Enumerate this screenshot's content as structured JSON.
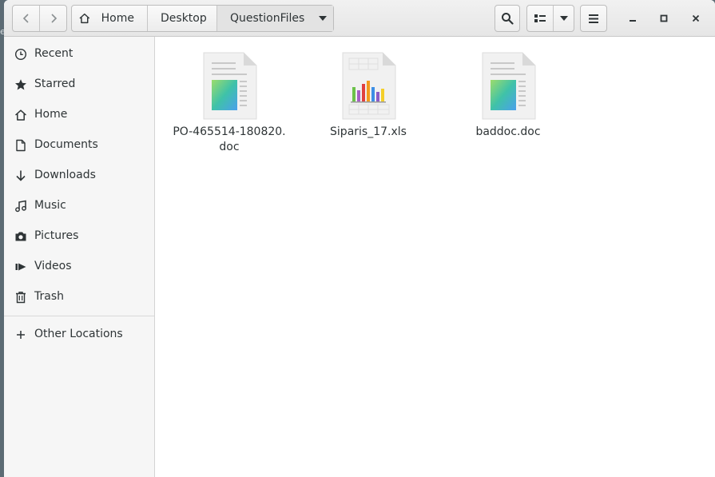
{
  "window_edge_char": "e",
  "header": {
    "breadcrumb": [
      "Home",
      "Desktop",
      "QuestionFiles"
    ]
  },
  "sidebar": {
    "items": [
      {
        "label": "Recent",
        "icon": "clock-icon"
      },
      {
        "label": "Starred",
        "icon": "star-icon"
      },
      {
        "label": "Home",
        "icon": "home-icon"
      },
      {
        "label": "Documents",
        "icon": "document-icon"
      },
      {
        "label": "Downloads",
        "icon": "download-icon"
      },
      {
        "label": "Music",
        "icon": "music-icon"
      },
      {
        "label": "Pictures",
        "icon": "camera-icon"
      },
      {
        "label": "Videos",
        "icon": "video-icon"
      },
      {
        "label": "Trash",
        "icon": "trash-icon"
      }
    ],
    "other_locations": "Other Locations"
  },
  "files": [
    {
      "name_line1": "PO-465514-180820.",
      "name_line2": "doc",
      "type": "document"
    },
    {
      "name_line1": "Siparis_17.xls",
      "name_line2": "",
      "type": "spreadsheet"
    },
    {
      "name_line1": "baddoc.doc",
      "name_line2": "",
      "type": "document"
    }
  ]
}
